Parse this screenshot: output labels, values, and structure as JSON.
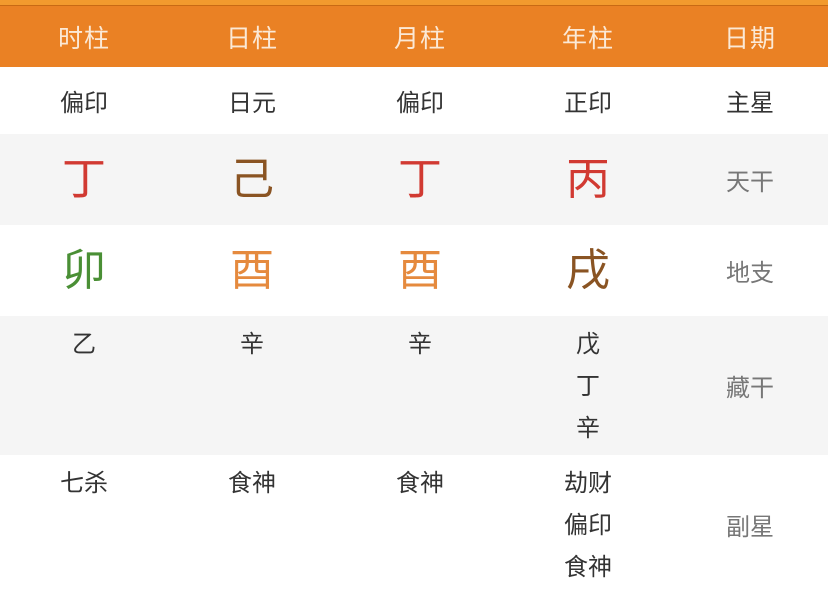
{
  "colors": {
    "header_bg": "#ea8124",
    "header_text": "#fbe9d6",
    "fire": "#d13a32",
    "earth_brown": "#8a5423",
    "wood_green": "#4a8f35",
    "metal_orange": "#e58a3e"
  },
  "header": {
    "columns": [
      "时柱",
      "日柱",
      "月柱",
      "年柱",
      "日期"
    ]
  },
  "rows": {
    "main_star": {
      "label": "主星",
      "values": [
        "偏印",
        "日元",
        "偏印",
        "正印"
      ]
    },
    "heavenly_stem": {
      "label": "天干",
      "values": [
        "丁",
        "己",
        "丁",
        "丙"
      ],
      "colors": [
        "#d13a32",
        "#8a5423",
        "#d13a32",
        "#d13a32"
      ]
    },
    "earthly_branch": {
      "label": "地支",
      "values": [
        "卯",
        "酉",
        "酉",
        "戌"
      ],
      "colors": [
        "#4a8f35",
        "#e58a3e",
        "#e58a3e",
        "#8a5423"
      ]
    },
    "hidden_stems": {
      "label": "藏干",
      "values": [
        [
          "乙"
        ],
        [
          "辛"
        ],
        [
          "辛"
        ],
        [
          "戊",
          "丁",
          "辛"
        ]
      ]
    },
    "sub_stars": {
      "label": "副星",
      "values": [
        [
          "七杀"
        ],
        [
          "食神"
        ],
        [
          "食神"
        ],
        [
          "劫财",
          "偏印",
          "食神"
        ]
      ]
    }
  }
}
